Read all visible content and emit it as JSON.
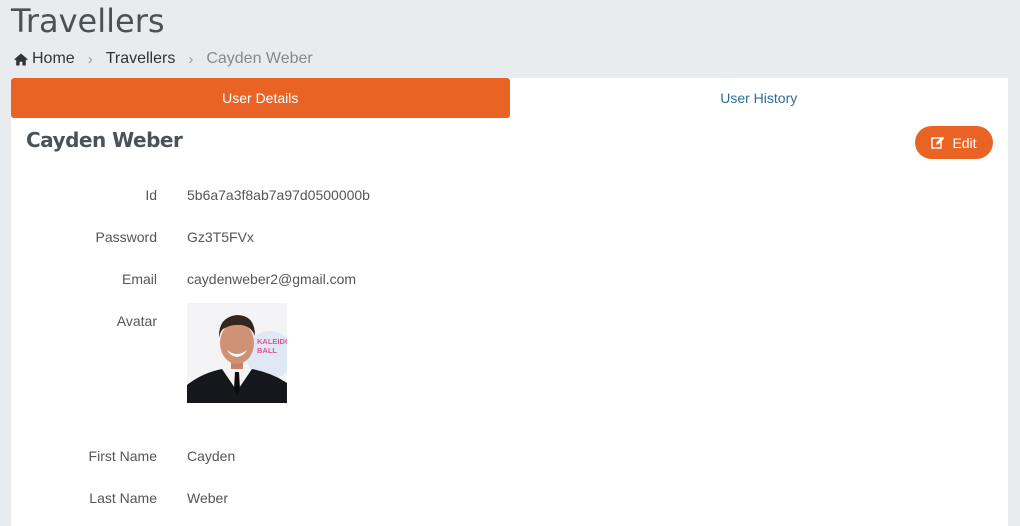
{
  "page": {
    "title": "Travellers"
  },
  "breadcrumb": {
    "home": "Home",
    "section": "Travellers",
    "current": "Cayden Weber"
  },
  "tabs": [
    {
      "label": "User Details"
    },
    {
      "label": "User History"
    }
  ],
  "profile": {
    "name": "Cayden Weber",
    "edit_label": "Edit",
    "avatar_text": "KALEIDO BALL",
    "fields": [
      {
        "label": "Id",
        "value": "5b6a7a3f8ab7a97d0500000b"
      },
      {
        "label": "Password",
        "value": "Gz3T5FVx"
      },
      {
        "label": "Email",
        "value": "caydenweber2@gmail.com"
      },
      {
        "label": "Avatar",
        "value": ""
      },
      {
        "label": "First Name",
        "value": "Cayden"
      },
      {
        "label": "Last Name",
        "value": "Weber"
      }
    ]
  },
  "colors": {
    "accent": "#e96424",
    "link": "#2a6f98",
    "background": "#e8ecee"
  },
  "icons": {
    "home": "home-icon",
    "edit": "edit-icon",
    "separator": "chevron-right-icon"
  }
}
